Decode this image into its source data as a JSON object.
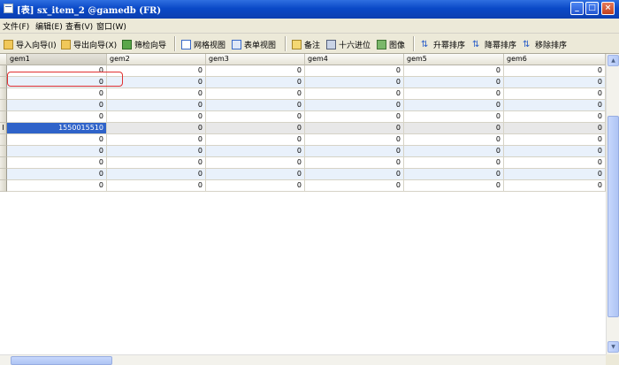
{
  "window": {
    "title": "[表] sx_item_2 @gamedb (FR)",
    "minimize_glyph": "_",
    "maximize_glyph": "□",
    "close_glyph": "×"
  },
  "menu": [
    "文件(F)",
    "编辑(E)",
    "查看(V)",
    "窗口(W)"
  ],
  "toolbar": {
    "items": [
      {
        "label": "导入向导(I)",
        "icon": "import-wizard-icon"
      },
      {
        "label": "导出向导(X)",
        "icon": "export-wizard-icon"
      },
      {
        "label": "筛检向导",
        "icon": "filter-wizard-icon"
      },
      {
        "label": "网格视图",
        "icon": "grid-view-icon"
      },
      {
        "label": "表单视图",
        "icon": "form-view-icon"
      },
      {
        "label": "备注",
        "icon": "memo-icon"
      },
      {
        "label": "十六进位",
        "icon": "hex-icon"
      },
      {
        "label": "图像",
        "icon": "image-icon"
      },
      {
        "label": "升幂排序",
        "icon": "sort-ascending-icon"
      },
      {
        "label": "降幂排序",
        "icon": "sort-descending-icon"
      },
      {
        "label": "移除排序",
        "icon": "remove-sort-icon"
      }
    ]
  },
  "grid": {
    "columns": [
      "gem1",
      "gem2",
      "gem3",
      "gem4",
      "gem5",
      "gem6"
    ],
    "current_row": 5,
    "edit_marker": "I",
    "rows": [
      [
        "0",
        "0",
        "0",
        "0",
        "0",
        "0"
      ],
      [
        "0",
        "0",
        "0",
        "0",
        "0",
        "0"
      ],
      [
        "0",
        "0",
        "0",
        "0",
        "0",
        "0"
      ],
      [
        "0",
        "0",
        "0",
        "0",
        "0",
        "0"
      ],
      [
        "0",
        "0",
        "0",
        "0",
        "0",
        "0"
      ],
      [
        "1550015510",
        "0",
        "0",
        "0",
        "0",
        "0"
      ],
      [
        "0",
        "0",
        "0",
        "0",
        "0",
        "0"
      ],
      [
        "0",
        "0",
        "0",
        "0",
        "0",
        "0"
      ],
      [
        "0",
        "0",
        "0",
        "0",
        "0",
        "0"
      ],
      [
        "0",
        "0",
        "0",
        "0",
        "0",
        "0"
      ],
      [
        "0",
        "0",
        "0",
        "0",
        "0",
        "0"
      ]
    ]
  },
  "colors": {
    "title_bar": "#0a49c7",
    "selection": "#2f63c9",
    "alt_row": "#e9f1fb",
    "highlight_ring": "#e03030"
  }
}
